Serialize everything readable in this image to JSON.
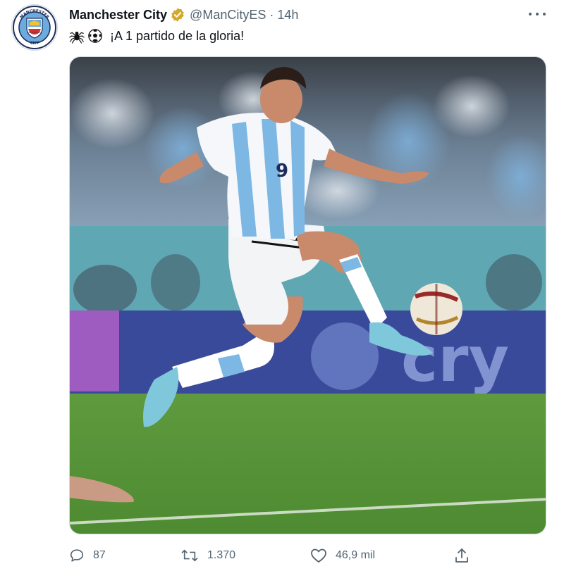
{
  "tweet": {
    "author": {
      "name": "Manchester City",
      "handle": "@ManCityES",
      "avatar_icon": "man-city-crest-icon",
      "avatar_text_top": "MANCHESTER",
      "avatar_text_bottom": "CITY",
      "verified_color": "#d4a92a"
    },
    "separator": "·",
    "time": "14h",
    "emojis": [
      "spider-emoji",
      "soccer-ball-emoji"
    ],
    "text": "¡A 1 partido de la gloria!",
    "media": {
      "description_icon": "football-player-photo",
      "ad_board_text": "cry"
    },
    "actions": {
      "reply_count": "87",
      "retweet_count": "1.370",
      "like_count": "46,9 mil"
    }
  },
  "colors": {
    "text_primary": "#0f1419",
    "text_secondary": "#536471",
    "border": "#cfd9de",
    "crest_blue": "#6cabdd"
  }
}
